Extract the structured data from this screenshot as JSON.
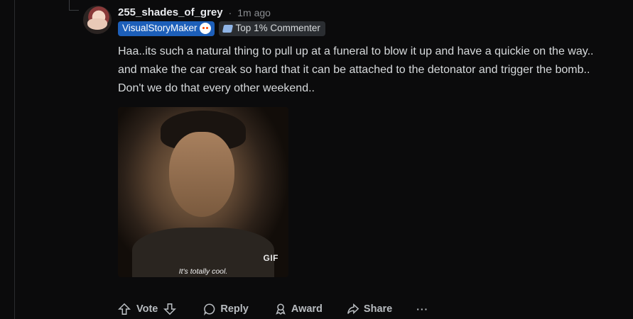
{
  "comment": {
    "username": "255_shades_of_grey",
    "separator": "·",
    "timestamp": "1m ago",
    "flairs": {
      "primary": "VisualStoryMaker",
      "secondary": "Top 1% Commenter"
    },
    "body": "Haa..its such a natural thing to pull up at a funeral to blow it up and have a quickie on the way.. and make the car creak so hard that it can be attached to the detonator and trigger the bomb.. Don't we do that every other weekend..",
    "gif": {
      "badge": "GIF",
      "caption": "It's totally cool."
    }
  },
  "actions": {
    "vote": "Vote",
    "reply": "Reply",
    "award": "Award",
    "share": "Share",
    "more": "···"
  },
  "colors": {
    "background": "#0b0b0c",
    "flair_blue": "#1d5fb9",
    "flair_gray": "#2a2d31",
    "text": "#d7dadc",
    "muted": "#8a8d91"
  }
}
